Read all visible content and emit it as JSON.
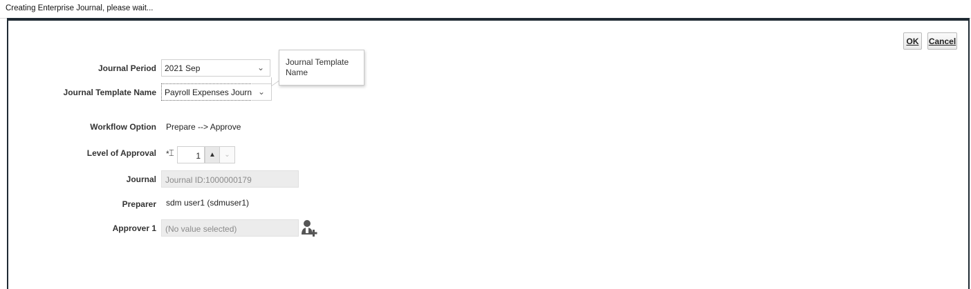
{
  "window": {
    "title": "Creating Enterprise Journal, please wait..."
  },
  "buttons": {
    "ok": "OK",
    "cancel": "Cancel"
  },
  "form": {
    "journal_period": {
      "label": "Journal Period",
      "value": "2021 Sep"
    },
    "journal_template": {
      "label": "Journal Template Name",
      "value": "Payroll Expenses Journal"
    },
    "tooltip": "Journal Template Name",
    "workflow_option": {
      "label": "Workflow Option",
      "value": "Prepare --> Approve"
    },
    "level_of_approval": {
      "label": "Level of Approval",
      "required_mark": "*",
      "value": "1"
    },
    "journal": {
      "label": "Journal",
      "value": "Journal ID:1000000179"
    },
    "preparer": {
      "label": "Preparer",
      "value": "sdm user1 (sdmuser1)"
    },
    "approver1": {
      "label": "Approver 1",
      "value": "(No value selected)"
    }
  },
  "icons": {
    "dropdown": "chevron-down-icon",
    "spin_up": "arrow-up-icon",
    "spin_down": "arrow-down-icon",
    "approver_search": "user-add-icon"
  }
}
